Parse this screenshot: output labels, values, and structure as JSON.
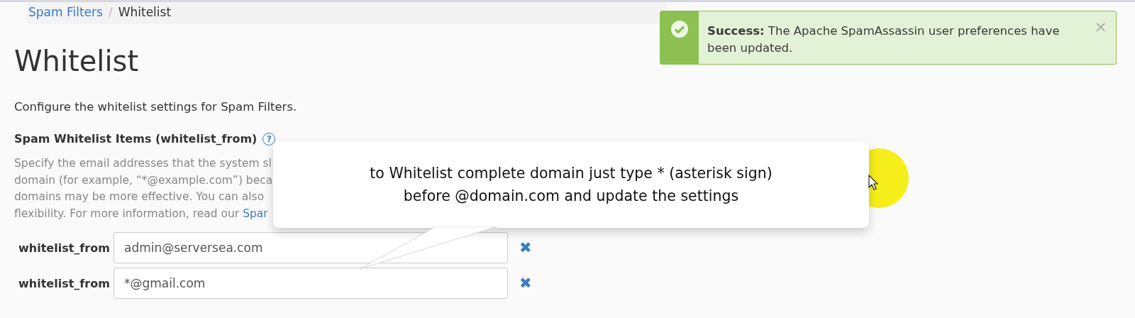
{
  "breadcrumb": [
    {
      "label": "Spam Filters",
      "kind": "link"
    },
    {
      "label": "Whitelist",
      "kind": "current"
    }
  ],
  "separator": "/",
  "title": "Whitelist",
  "intro": "Configure the whitelist settings for Spam Filters.",
  "section": {
    "heading": "Spam Whitelist Items (whitelist_from)",
    "help_icon": "?",
    "description": [
      {
        "text": "Specify the email addresses that the system sl"
      },
      {
        "text": "domain (for example, “*@example.com”) beca"
      },
      {
        "text": "domains may be more effective. You can also"
      },
      {
        "text": "flexibility. For more information, read our ",
        "link": "Spar"
      }
    ]
  },
  "entries": [
    {
      "label": "whitelist_from",
      "value": "admin@serversea.com",
      "remove": "✖"
    },
    {
      "label": "whitelist_from",
      "value": "*@gmail.com",
      "remove": "✖"
    }
  ],
  "toast": {
    "title": "Success:",
    "message": "The Apache SpamAssassin user preferences have been updated.",
    "close": "×"
  },
  "callout": {
    "lines": [
      "to Whitelist complete domain just type * (asterisk sign)",
      "before @domain.com and update the settings"
    ]
  }
}
